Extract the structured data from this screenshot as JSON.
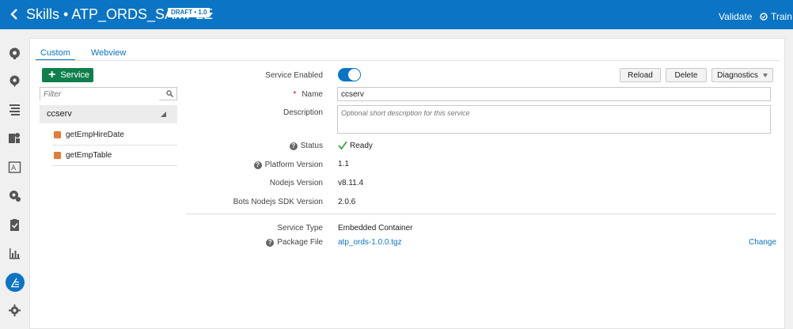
{
  "header": {
    "title": "Skills • ATP_ORDS_SAMPLE",
    "badge": "DRAFT • 1.0",
    "validate_label": "Validate",
    "train_label": "Train",
    "color": "#0b74c4"
  },
  "rail": {
    "icons": [
      "intents-icon",
      "entities-icon",
      "flows-icon",
      "resource-bundles-icon",
      "q-and-a-icon",
      "quality-icon",
      "test-icon",
      "insights-icon",
      "components-icon",
      "settings-icon"
    ],
    "active": "components-icon"
  },
  "tabs": [
    "Custom",
    "Webview"
  ],
  "sidebar": {
    "add_label": "Service",
    "filter_placeholder": "Filter",
    "service": "ccserv",
    "handlers": [
      "getEmpHireDate",
      "getEmpTable"
    ]
  },
  "form": {
    "service_enabled_label": "Service Enabled",
    "service_enabled": true,
    "reload_label": "Reload",
    "delete_label": "Delete",
    "diagnostics_label": "Diagnostics",
    "name_label": "Name",
    "name_required_mark": "*",
    "name_value": "ccserv",
    "description_label": "Description",
    "description_placeholder": "Optional short description for this service",
    "status_label": "Status",
    "status_value": "Ready",
    "platform_version_label": "Platform Version",
    "platform_version": "1.1",
    "nodejs_version_label": "Nodejs Version",
    "nodejs_version": "v8.11.4",
    "sdk_version_label": "Bots Nodejs SDK Version",
    "sdk_version": "2.0.6",
    "service_type_label": "Service Type",
    "service_type": "Embedded Container",
    "package_file_label": "Package File",
    "package_file": "atp_ords-1.0.0.tgz",
    "change_label": "Change",
    "help_glyph": "?"
  }
}
